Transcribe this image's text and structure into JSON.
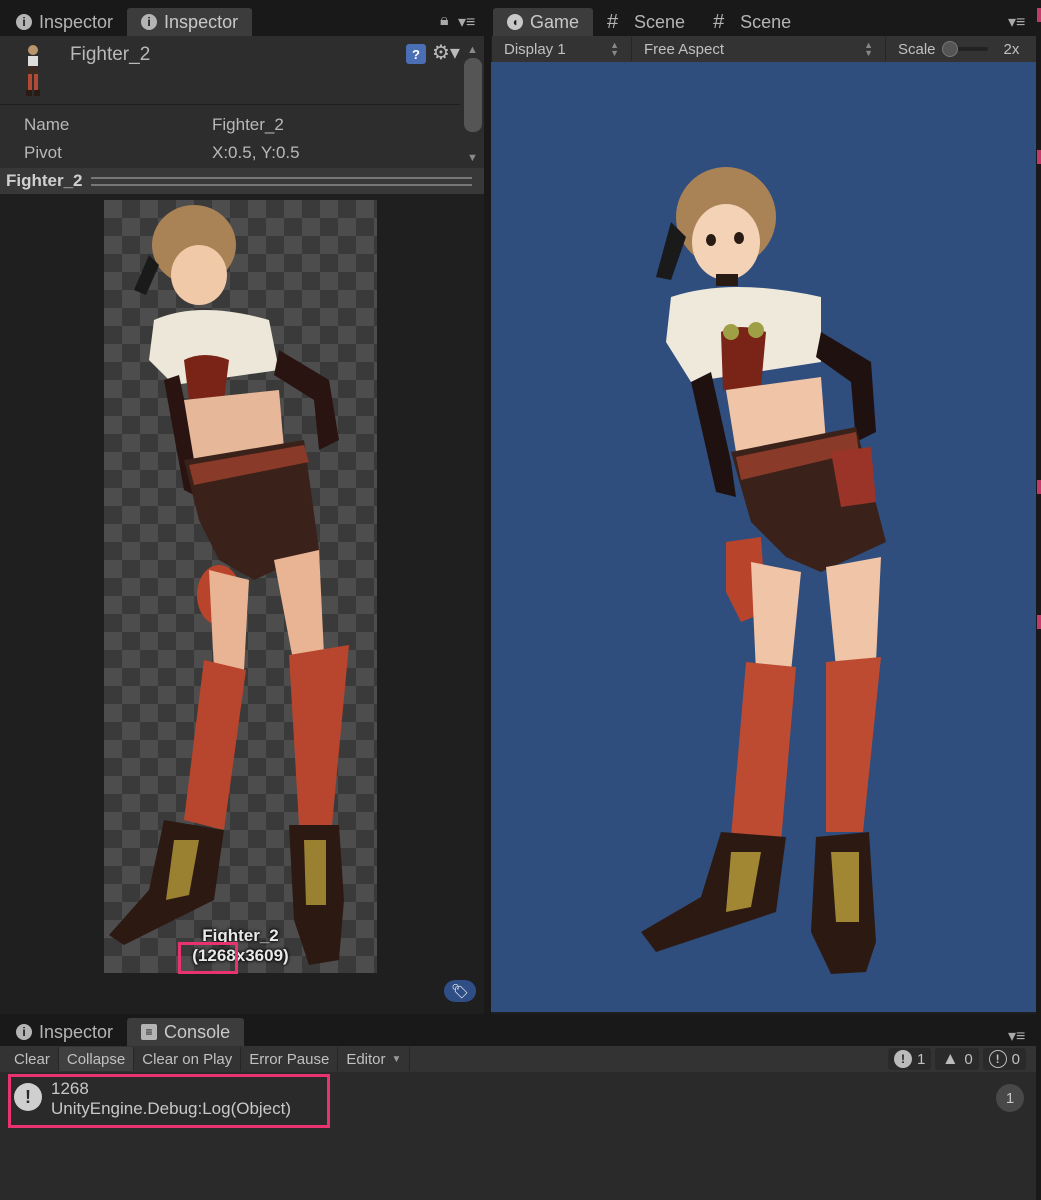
{
  "top_left_tabs": [
    {
      "label": "Inspector",
      "icon": "info-icon",
      "active": false
    },
    {
      "label": "Inspector",
      "icon": "info-icon",
      "active": true
    }
  ],
  "top_right_tabs": [
    {
      "label": "Game",
      "icon": "game-icon",
      "active": true
    },
    {
      "label": "Scene",
      "icon": "grid-icon",
      "active": false
    },
    {
      "label": "Scene",
      "icon": "grid-icon",
      "active": false
    }
  ],
  "inspector": {
    "asset_title": "Fighter_2",
    "properties": [
      {
        "key": "Name",
        "value": "Fighter_2"
      },
      {
        "key": "Pivot",
        "value": "X:0.5, Y:0.5"
      }
    ],
    "preview_header": "Fighter_2",
    "preview_caption_name": "Fighter_2",
    "preview_caption_size": "(1268x3609)"
  },
  "game_toolbar": {
    "display": "Display 1",
    "aspect": "Free Aspect",
    "scale_label": "Scale",
    "scale_value": "2x",
    "scale_level": 0.0
  },
  "bottom_tabs": [
    {
      "label": "Inspector",
      "icon": "info-icon",
      "active": false
    },
    {
      "label": "Console",
      "icon": "console-icon",
      "active": true
    }
  ],
  "console_toolbar": {
    "clear": "Clear",
    "collapse": "Collapse",
    "clear_on_play": "Clear on Play",
    "error_pause": "Error Pause",
    "editor": "Editor",
    "log_count": "1",
    "warning_count": "0",
    "error_count": "0"
  },
  "console_entries": [
    {
      "line1": "1268",
      "line2": "UnityEngine.Debug:Log(Object)",
      "count": "1"
    }
  ],
  "colors": {
    "game_background": "#2f4d7d",
    "highlight": "#e8336e"
  }
}
